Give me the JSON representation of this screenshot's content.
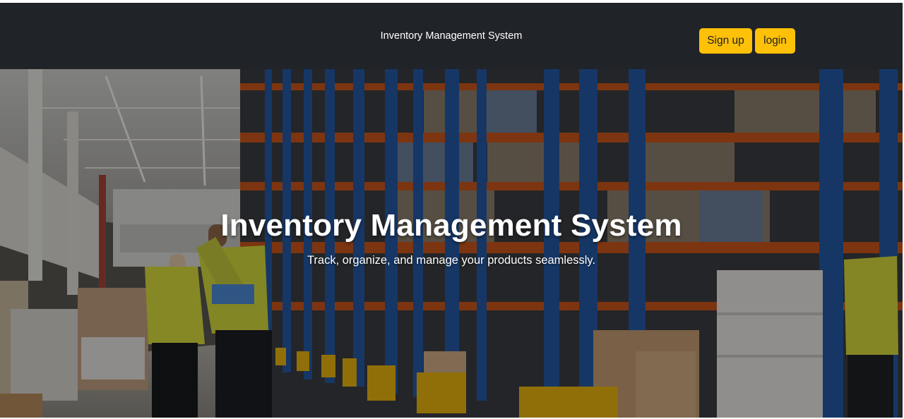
{
  "navbar": {
    "title": "Inventory Management System",
    "signup_label": "Sign up",
    "login_label": "login",
    "background_color": "#202327",
    "button_color": "#ffc107"
  },
  "hero": {
    "title": "Inventory Management System",
    "subtitle": "Track, organize, and manage your products seamlessly.",
    "image": "warehouse-photo"
  }
}
